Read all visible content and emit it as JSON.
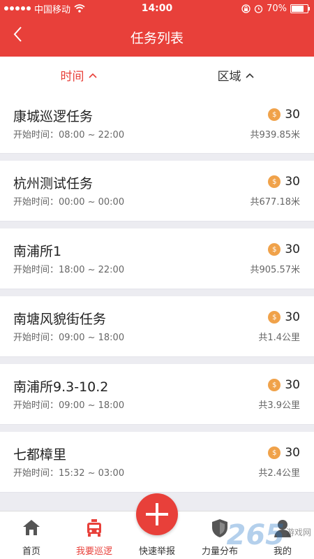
{
  "status": {
    "carrier": "中国移动",
    "time": "14:00",
    "battery": "70%"
  },
  "nav": {
    "title": "任务列表"
  },
  "filters": [
    {
      "label": "时间",
      "active": true
    },
    {
      "label": "区域",
      "active": false
    }
  ],
  "tasks": [
    {
      "name": "康城巡逻任务",
      "start": "开始时间：08:00 ~ 22:00",
      "reward": "30",
      "distance": "共939.85米"
    },
    {
      "name": "杭州测试任务",
      "start": "开始时间：00:00 ~ 00:00",
      "reward": "30",
      "distance": "共677.18米"
    },
    {
      "name": "南浦所1",
      "start": "开始时间：18:00 ~ 22:00",
      "reward": "30",
      "distance": "共905.57米"
    },
    {
      "name": "南塘风貌街任务",
      "start": "开始时间：09:00 ~ 18:00",
      "reward": "30",
      "distance": "共1.4公里"
    },
    {
      "name": "南浦所9.3-10.2",
      "start": "开始时间：09:00 ~ 18:00",
      "reward": "30",
      "distance": "共3.9公里"
    },
    {
      "name": "七都樟里",
      "start": "开始时间：15:32 ~ 03:00",
      "reward": "30",
      "distance": "共2.4公里"
    }
  ],
  "tabs": [
    {
      "label": "首页",
      "icon": "home-icon"
    },
    {
      "label": "我要巡逻",
      "icon": "patrol-car-icon"
    },
    {
      "label": "快速举报",
      "icon": "plus-icon"
    },
    {
      "label": "力量分布",
      "icon": "shield-icon"
    },
    {
      "label": "我的",
      "icon": "user-icon"
    }
  ],
  "watermark": {
    "big": "265",
    "small": "游戏网"
  },
  "colors": {
    "accent": "#e8403a",
    "coin": "#f0a24a"
  }
}
